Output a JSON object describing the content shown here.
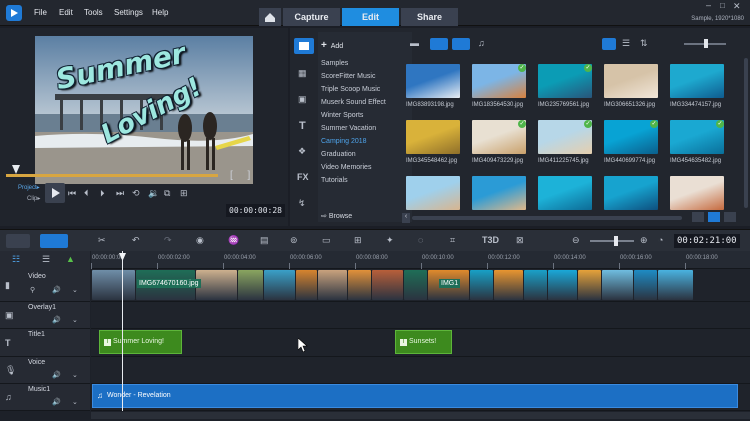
{
  "menu": [
    "File",
    "Edit",
    "Tools",
    "Settings",
    "Help"
  ],
  "tabs": {
    "capture": "Capture",
    "edit": "Edit",
    "share": "Share"
  },
  "project_info": "Sample, 1920*1080",
  "preview": {
    "title_line1": "Summer",
    "title_line2": "Loving!",
    "project_label": "Project▸",
    "clip_label": "Clip▸",
    "timecode": "00:00:00:28",
    "brackets": "[ ]"
  },
  "library": {
    "add_label": "Add",
    "items": [
      "Samples",
      "ScoreFitter Music",
      "Triple Scoop Music",
      "Muserk Sound Effect",
      "Winter Sports",
      "Summer Vacation",
      "Camping 2018",
      "Graduation",
      "Video Memories",
      "Tutorials"
    ],
    "selected": "Camping 2018",
    "browse_label": "Browse",
    "thumbs": [
      {
        "name": "IMG83893198.jpg",
        "checked": false,
        "c1": "#2f76c1",
        "c2": "#e9eef4"
      },
      {
        "name": "IMG183564530.jpg",
        "checked": true,
        "c1": "#7cb5e6",
        "c2": "#d9823f"
      },
      {
        "name": "IMG235769561.jpg",
        "checked": true,
        "c1": "#0b9cb5",
        "c2": "#29557a"
      },
      {
        "name": "IMG306651326.jpg",
        "checked": false,
        "c1": "#d6c3a8",
        "c2": "#f1e6d9"
      },
      {
        "name": "IMG334474157.jpg",
        "checked": false,
        "c1": "#1ea9cf",
        "c2": "#0f5c8f"
      },
      {
        "name": "IMG345548462.jpg",
        "checked": false,
        "c1": "#d9b23a",
        "c2": "#8f6f2a"
      },
      {
        "name": "IMG409473229.jpg",
        "checked": true,
        "c1": "#e8e0d2",
        "c2": "#c9a06a"
      },
      {
        "name": "IMG411225745.jpg",
        "checked": true,
        "c1": "#b7d7e8",
        "c2": "#e6cfae"
      },
      {
        "name": "IMG440699774.jpg",
        "checked": true,
        "c1": "#08a3d4",
        "c2": "#0b5f8c"
      },
      {
        "name": "IMG454635482.jpg",
        "checked": true,
        "c1": "#1aa8d2",
        "c2": "#0a6f9a"
      },
      {
        "name": "",
        "checked": false,
        "c1": "#9fd0ec",
        "c2": "#d8b58f"
      },
      {
        "name": "",
        "checked": false,
        "c1": "#2b9bd6",
        "c2": "#e0b88a"
      },
      {
        "name": "",
        "checked": false,
        "c1": "#1db2d8",
        "c2": "#0d6b96"
      },
      {
        "name": "",
        "checked": false,
        "c1": "#17a3cf",
        "c2": "#0e4f7e"
      },
      {
        "name": "",
        "checked": false,
        "c1": "#eadfd4",
        "c2": "#c66a3e"
      }
    ]
  },
  "toolbar": {
    "zoom_time": "00:02:21:00"
  },
  "ruler": [
    "00:00:00:00",
    "00:00:02:00",
    "00:00:04:00",
    "00:00:06:00",
    "00:00:08:00",
    "00:00:10:00",
    "00:00:12:00",
    "00:00:14:00",
    "00:00:16:00",
    "00:00:18:00"
  ],
  "tracks": {
    "video": "Video",
    "overlay": "Overlay1",
    "title": "Title1",
    "voice": "Voice",
    "music": "Music1"
  },
  "clips": {
    "video_label_1": "IMG674670160.jpg",
    "video_label_2": "IMG1",
    "title_1": "Summer Loving!",
    "title_2": "Sunsets!",
    "music": "Wonder - Revelation"
  },
  "colors": {
    "accent": "#1f7ad6",
    "title_clip": "#3d8a1e",
    "music_clip": "#1c6fc4"
  }
}
